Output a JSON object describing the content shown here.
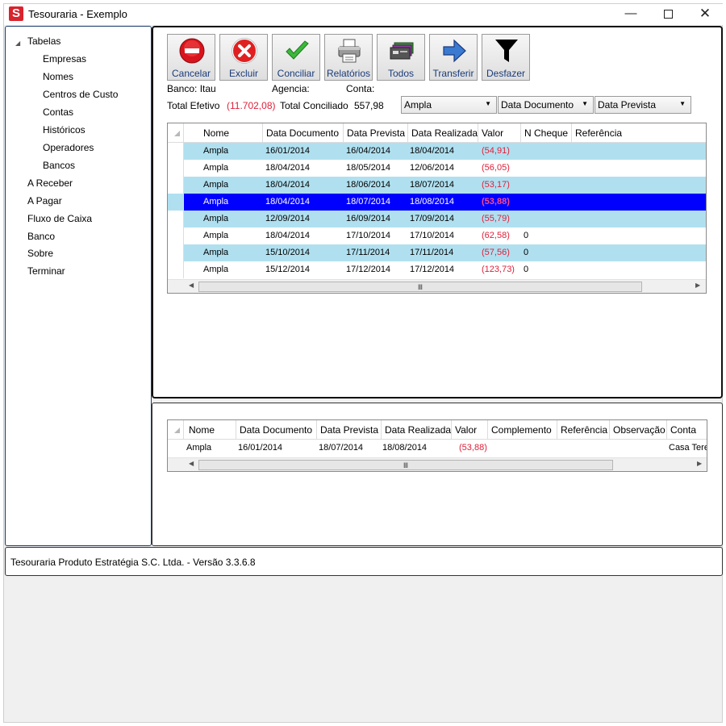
{
  "window": {
    "app_icon_letter": "S",
    "title": "Tesouraria - Exemplo",
    "minimize": "—",
    "close": "✕"
  },
  "sidebar": {
    "root": "Tabelas",
    "children": [
      "Empresas",
      "Nomes",
      "Centros de Custo",
      "Contas",
      "Históricos",
      "Operadores",
      "Bancos"
    ],
    "items": [
      "A Receber",
      "A Pagar",
      "Fluxo de Caixa",
      "Banco",
      "Sobre",
      "Terminar"
    ]
  },
  "toolbar": {
    "buttons": [
      {
        "label": "Cancelar",
        "icon": "cancel-icon"
      },
      {
        "label": "Excluir",
        "icon": "delete-icon"
      },
      {
        "label": "Conciliar",
        "icon": "checkmark-icon"
      },
      {
        "label": "Relatórios",
        "icon": "printer-icon"
      },
      {
        "label": "Todos",
        "icon": "stack-icon"
      },
      {
        "label": "Transferir",
        "icon": "arrow-right-icon"
      },
      {
        "label": "Desfazer",
        "icon": "funnel-icon"
      }
    ]
  },
  "info": {
    "banco": "Banco: Itau",
    "agencia": "Agencia:",
    "conta": "Conta:",
    "total_efetivo_label": "Total Efetivo",
    "total_efetivo_value": "(11.702,08)",
    "total_conciliado_label": "Total Conciliado",
    "total_conciliado_value": "557,98"
  },
  "filters": {
    "name": "Ampla",
    "date_type": "Data Documento",
    "date_order": "Data Prevista"
  },
  "main_grid": {
    "columns": [
      "Nome",
      "Data Documento",
      "Data Prevista",
      "Data Realizada",
      "Valor",
      "N Cheque",
      "Referência"
    ],
    "rows": [
      {
        "nome": "Ampla",
        "doc": "16/01/2014",
        "prev": "16/04/2014",
        "real": "18/04/2014",
        "valor": "(54,91)",
        "cheque": ""
      },
      {
        "nome": "Ampla",
        "doc": "18/04/2014",
        "prev": "18/05/2014",
        "real": "12/06/2014",
        "valor": "(56,05)",
        "cheque": ""
      },
      {
        "nome": "Ampla",
        "doc": "18/04/2014",
        "prev": "18/06/2014",
        "real": "18/07/2014",
        "valor": "(53,17)",
        "cheque": ""
      },
      {
        "nome": "Ampla",
        "doc": "18/04/2014",
        "prev": "18/07/2014",
        "real": "18/08/2014",
        "valor": "(53,88)",
        "cheque": ""
      },
      {
        "nome": "Ampla",
        "doc": "12/09/2014",
        "prev": "16/09/2014",
        "real": "17/09/2014",
        "valor": "(55,79)",
        "cheque": ""
      },
      {
        "nome": "Ampla",
        "doc": "18/04/2014",
        "prev": "17/10/2014",
        "real": "17/10/2014",
        "valor": "(62,58)",
        "cheque": "0"
      },
      {
        "nome": "Ampla",
        "doc": "15/10/2014",
        "prev": "17/11/2014",
        "real": "17/11/2014",
        "valor": "(57,56)",
        "cheque": "0"
      },
      {
        "nome": "Ampla",
        "doc": "15/12/2014",
        "prev": "17/12/2014",
        "real": "17/12/2014",
        "valor": "(123,73)",
        "cheque": "0"
      }
    ],
    "selected_index": 3,
    "scroll_grip": "Ⅲ"
  },
  "detail_grid": {
    "columns": [
      "Nome",
      "Data Documento",
      "Data Prevista",
      "Data Realizada",
      "Valor",
      "Complemento",
      "Referência",
      "Observação",
      "Conta"
    ],
    "rows": [
      {
        "nome": "Ampla",
        "doc": "16/01/2014",
        "prev": "18/07/2014",
        "real": "18/08/2014",
        "valor": "(53,88)",
        "complemento": "",
        "referencia": "",
        "observacao": "",
        "conta": "Casa Tere"
      }
    ],
    "scroll_grip": "Ⅲ"
  },
  "status": {
    "text": "Tesouraria Produto Estratégia S.C. Ltda. -  Versão 3.3.6.8"
  },
  "colors": {
    "row_alt": "#b0e0f0",
    "row_selected": "#0000ff",
    "negative": "#e0203a",
    "panel_border": "#111111"
  }
}
